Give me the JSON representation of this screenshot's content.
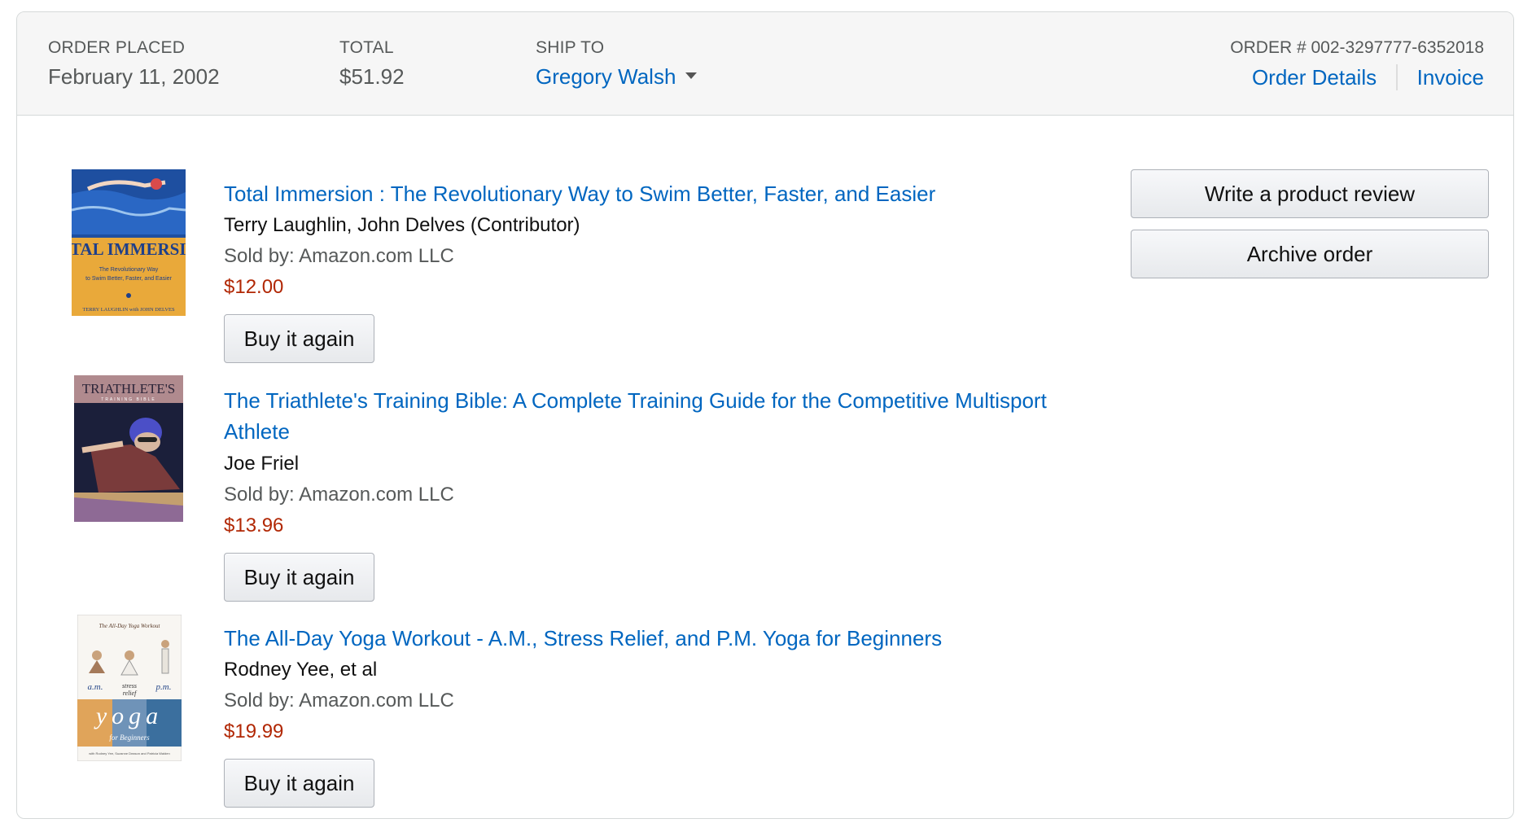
{
  "header": {
    "order_placed_label": "ORDER PLACED",
    "order_placed_value": "February 11, 2002",
    "total_label": "TOTAL",
    "total_value": "$51.92",
    "ship_to_label": "SHIP TO",
    "ship_to_value": "Gregory Walsh",
    "order_number": "ORDER # 002-3297777-6352018",
    "order_details_label": "Order Details",
    "invoice_label": "Invoice"
  },
  "actions": {
    "write_review_label": "Write a product review",
    "archive_order_label": "Archive order"
  },
  "items": [
    {
      "title": "Total Immersion : The Revolutionary Way to Swim Better, Faster, and Easier",
      "author": "Terry Laughlin, John Delves (Contributor)",
      "sold_by": "Sold by: Amazon.com LLC",
      "price": "$12.00",
      "buy_again_label": "Buy it again",
      "cover": {
        "title": "TOTAL IMMERSION",
        "subtitle": "The Revolutionary Way to Swim Better, Faster, and Easier",
        "authors": "TERRY LAUGHLIN with JOHN DELVES"
      }
    },
    {
      "title": "The Triathlete's Training Bible: A Complete Training Guide for the Competitive Multisport Athlete",
      "author": "Joe Friel",
      "sold_by": "Sold by: Amazon.com LLC",
      "price": "$13.96",
      "buy_again_label": "Buy it again",
      "cover": {
        "title": "TRIATHLETE'S",
        "subtitle": "TRAINING BIBLE"
      }
    },
    {
      "title": "The All-Day Yoga Workout - A.M., Stress Relief, and P.M. Yoga for Beginners",
      "author": "Rodney Yee, et al",
      "sold_by": "Sold by: Amazon.com LLC",
      "price": "$19.99",
      "buy_again_label": "Buy it again",
      "cover": {
        "top": "The All-Day Yoga Workout",
        "am": "a.m.",
        "stress": "stress relief",
        "pm": "p.m.",
        "yoga": "yoga",
        "beginners": "for Beginners"
      }
    }
  ],
  "colors": {
    "link": "#0066c0",
    "price": "#b12704",
    "header_bg": "#f6f6f6"
  }
}
